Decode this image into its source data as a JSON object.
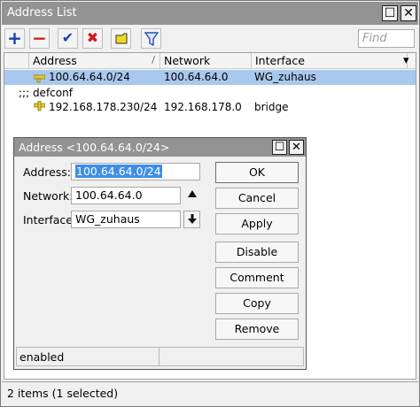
{
  "window": {
    "title": "Address List",
    "restore_glyph": "☐",
    "close_glyph": "✕"
  },
  "toolbar": {
    "add_icon": "+",
    "remove_icon": "−",
    "enable_icon": "✔",
    "disable_icon": "✖",
    "comment_icon": "▭",
    "filter_icon": "▽",
    "find_placeholder": "Find"
  },
  "table": {
    "columns": [
      "Address",
      "Network",
      "Interface"
    ],
    "sort_marker": "/",
    "dropdown_marker": "▾",
    "rows": [
      {
        "type": "entry",
        "address": "100.64.64.0/24",
        "network": "100.64.64.0",
        "interface": "WG_zuhaus",
        "selected": true
      },
      {
        "type": "comment",
        "text": ";;; defconf"
      },
      {
        "type": "entry",
        "address": "192.168.178.230/24",
        "network": "192.168.178.0",
        "interface": "bridge",
        "selected": false
      }
    ]
  },
  "status": {
    "text": "2 items (1 selected)"
  },
  "dialog": {
    "title": "Address <100.64.64.0/24>",
    "fields": {
      "address_label": "Address:",
      "address_value": "100.64.64.0/24",
      "network_label": "Network:",
      "network_value": "100.64.64.0",
      "interface_label": "Interface:",
      "interface_value": "WG_zuhaus"
    },
    "buttons": {
      "ok": "OK",
      "cancel": "Cancel",
      "apply": "Apply",
      "disable": "Disable",
      "comment": "Comment",
      "copy": "Copy",
      "remove": "Remove"
    },
    "status": "enabled"
  },
  "colors": {
    "title_bar": "#939393",
    "selected_row": "#a9c8ee",
    "add_icon": "#1a3fb5",
    "remove_icon": "#c62020",
    "enable_icon": "#1a3fb5",
    "disable_icon": "#d01c1c",
    "comment_icon": "#f2d81f",
    "filter_icon": "#2a4fb0",
    "address_icon": "#e3c930"
  }
}
